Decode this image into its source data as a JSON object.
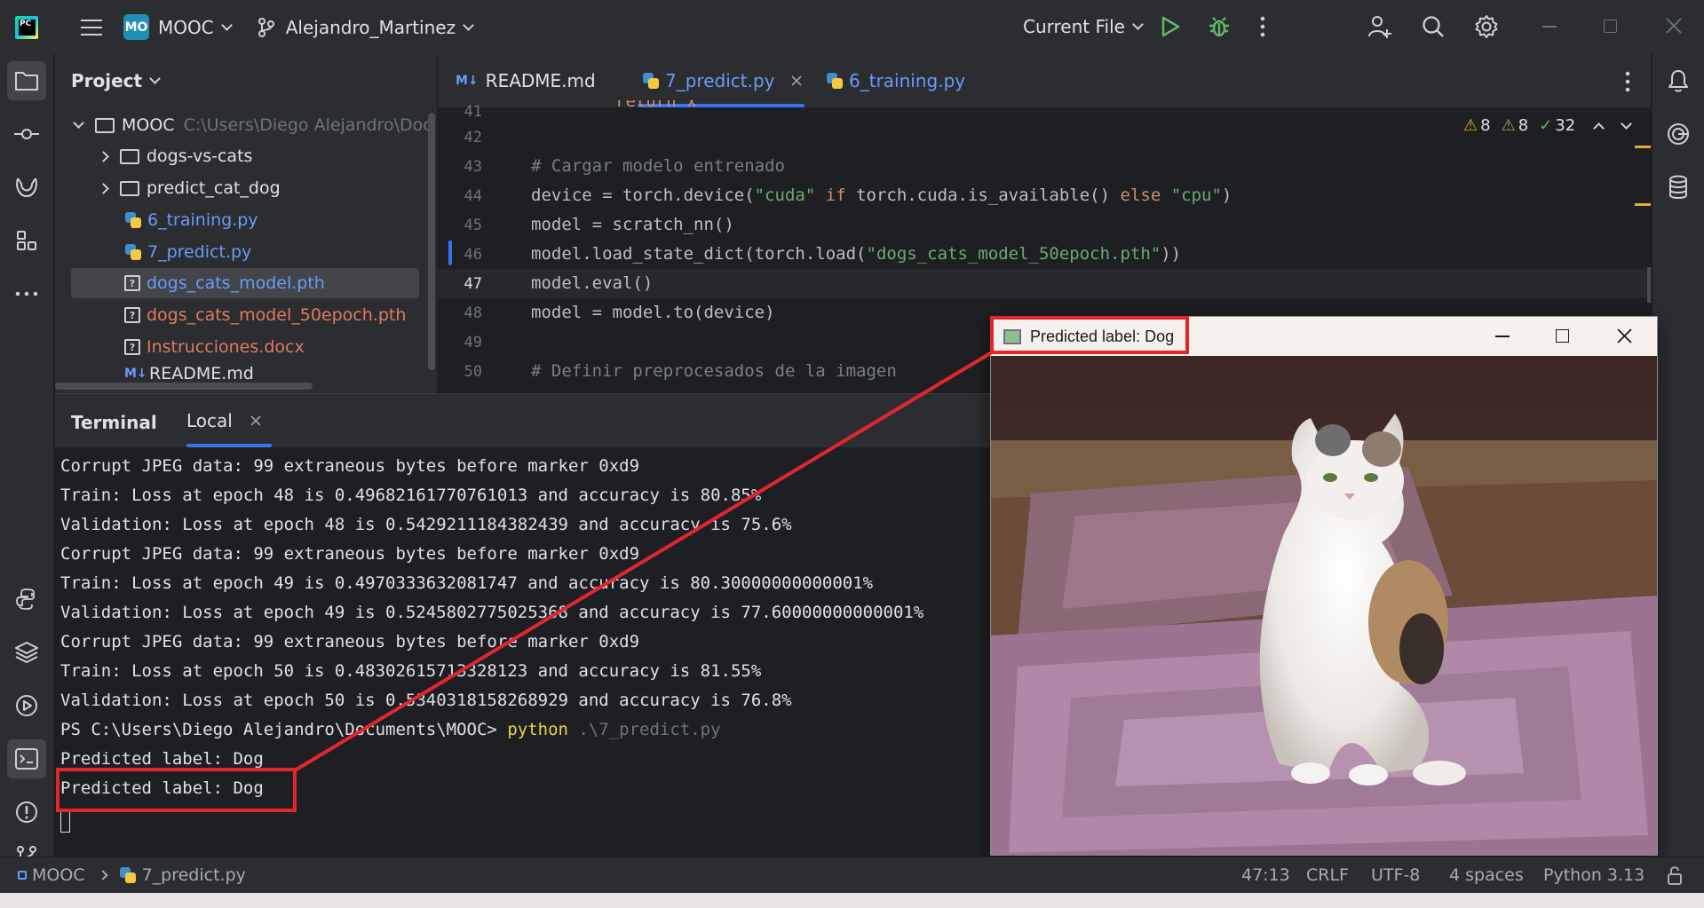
{
  "titlebar": {
    "project_badge": "MO",
    "project_name": "MOOC",
    "branch": "Alejandro_Martinez",
    "run_config": "Current File"
  },
  "project_panel": {
    "title": "Project",
    "root_name": "MOOC",
    "root_path": "C:\\Users\\Diego Alejandro\\Doc",
    "items": [
      {
        "label": "dogs-vs-cats",
        "kind": "folder"
      },
      {
        "label": "predict_cat_dog",
        "kind": "folder"
      },
      {
        "label": "6_training.py",
        "kind": "python"
      },
      {
        "label": "7_predict.py",
        "kind": "python"
      },
      {
        "label": "dogs_cats_model.pth",
        "kind": "unknown"
      },
      {
        "label": "dogs_cats_model_50epoch.pth",
        "kind": "unknown"
      },
      {
        "label": "Instrucciones.docx",
        "kind": "unknown"
      },
      {
        "label": "README.md",
        "kind": "markdown"
      }
    ]
  },
  "editor": {
    "tabs": [
      {
        "label": "README.md",
        "icon": "M↓"
      },
      {
        "label": "7_predict.py",
        "active": true
      },
      {
        "label": "6_training.py"
      }
    ],
    "inspections": {
      "warnings": "8",
      "weak_warnings": "8",
      "ok": "32"
    },
    "line_numbers": [
      "41",
      "42",
      "43",
      "44",
      "45",
      "46",
      "47",
      "48",
      "49",
      "50"
    ],
    "top_partial": "return x",
    "lines": {
      "l43_comment": "# Cargar modelo entrenado",
      "l44_a": "device = torch.device(",
      "l44_b": "\"cuda\"",
      "l44_c": " if ",
      "l44_d": "torch.cuda.is_available()",
      "l44_e": " else ",
      "l44_f": "\"cpu\"",
      "l44_g": ")",
      "l45": "model = scratch_nn()",
      "l46_a": "model.load_state_dict(torch.load(",
      "l46_b": "\"dogs_cats_model_50epoch.pth\"",
      "l46_c": "))",
      "l47": "model.eval()",
      "l48": "model = model.to(device)",
      "l50_comment": "# Definir preprocesados de la imagen"
    }
  },
  "terminal": {
    "title": "Terminal",
    "tab": "Local",
    "lines": [
      "Corrupt JPEG data: 99 extraneous bytes before marker 0xd9",
      "Train: Loss at epoch 48 is 0.49682161770761013 and accuracy is 80.85%",
      "Validation: Loss at epoch 48 is 0.5429211184382439 and accuracy is 75.6%",
      "Corrupt JPEG data: 99 extraneous bytes before marker 0xd9",
      "Train: Loss at epoch 49 is 0.4970333632081747 and accuracy is 80.30000000000001%",
      "Validation: Loss at epoch 49 is 0.5245802775025368 and accuracy is 77.60000000000001%",
      "Corrupt JPEG data: 99 extraneous bytes before marker 0xd9",
      "Train: Loss at epoch 50 is 0.48302615713328123 and accuracy is 81.55%",
      "Validation: Loss at epoch 50 is 0.5340318158268929 and accuracy is 76.8%"
    ],
    "prompt": "PS C:\\Users\\Diego Alejandro\\Documents\\MOOC> ",
    "command": "python",
    "command_arg": " .\\7_predict.py",
    "output_1": "Predicted label: Dog",
    "output_2": "Predicted label: Dog"
  },
  "popup": {
    "title": "Predicted label: Dog"
  },
  "statusbar": {
    "breadcrumb_root": "MOOC",
    "breadcrumb_file": "7_predict.py",
    "position": "47:13",
    "line_sep": "CRLF",
    "encoding": "UTF-8",
    "indent": "4 spaces",
    "interpreter": "Python 3.13"
  },
  "colors": {
    "accent": "#3574f0",
    "annotation_red": "#e3262b",
    "keyword": "#cf8e6d",
    "string": "#6aab73"
  }
}
